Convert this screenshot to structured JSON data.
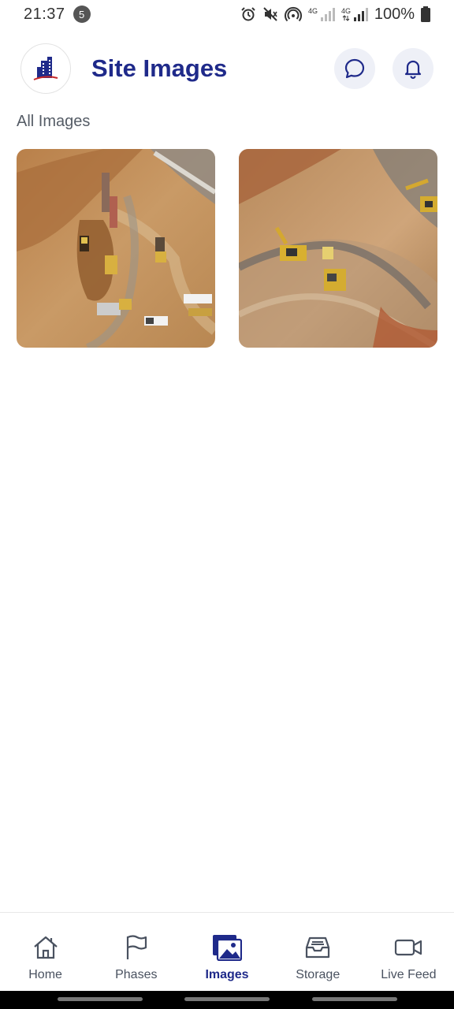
{
  "status_bar": {
    "time": "21:37",
    "notification_count": "5",
    "battery": "100%"
  },
  "header": {
    "title": "Site Images",
    "chat_icon": "chat-bubble-icon",
    "bell_icon": "bell-icon",
    "logo_icon": "building-logo-icon"
  },
  "section": {
    "label": "All Images"
  },
  "images": [
    {
      "name": "construction-site-image-1"
    },
    {
      "name": "construction-site-image-2"
    }
  ],
  "nav": {
    "items": [
      {
        "label": "Home",
        "icon": "home-icon",
        "active": false
      },
      {
        "label": "Phases",
        "icon": "flag-icon",
        "active": false
      },
      {
        "label": "Images",
        "icon": "image-gallery-icon",
        "active": true
      },
      {
        "label": "Storage",
        "icon": "inbox-tray-icon",
        "active": false
      },
      {
        "label": "Live Feed",
        "icon": "video-camera-icon",
        "active": false
      }
    ]
  },
  "colors": {
    "brand": "#1f2a8a",
    "header_button_bg": "#eef0f7",
    "muted_text": "#555c66"
  }
}
